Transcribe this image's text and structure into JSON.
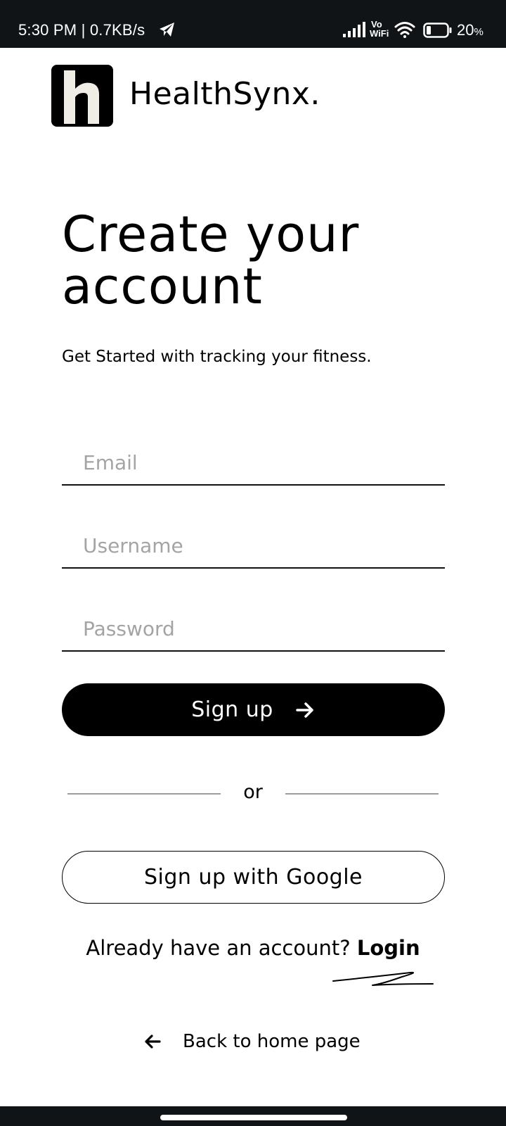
{
  "status_bar": {
    "time": "5:30 PM | 0.7KB/s",
    "vo": "Vo",
    "wifi_label": "WiFi",
    "battery_value": "20",
    "battery_unit": "%",
    "icons": [
      "telegram-icon",
      "signal-icon",
      "wifi-icon",
      "battery-icon"
    ]
  },
  "brand": {
    "logo_letter": "h",
    "name": "HealthSynx."
  },
  "headline": {
    "line1": "Create your",
    "line2": "account"
  },
  "subhead": "Get Started with tracking your fitness.",
  "form": {
    "email_placeholder": "Email",
    "username_placeholder": "Username",
    "password_placeholder": "Password",
    "submit_label": "Sign up"
  },
  "divider_text": "or",
  "google_label": "Sign up with Google",
  "login_prompt": {
    "text": "Already have an account?",
    "link": "Login"
  },
  "back_label": "Back to home page",
  "colors": {
    "status_bar_bg": "#111417",
    "primary": "#000000",
    "placeholder": "#a4a4a4",
    "divider": "#9a9ca0",
    "logo_letter": "#f0ede6"
  }
}
